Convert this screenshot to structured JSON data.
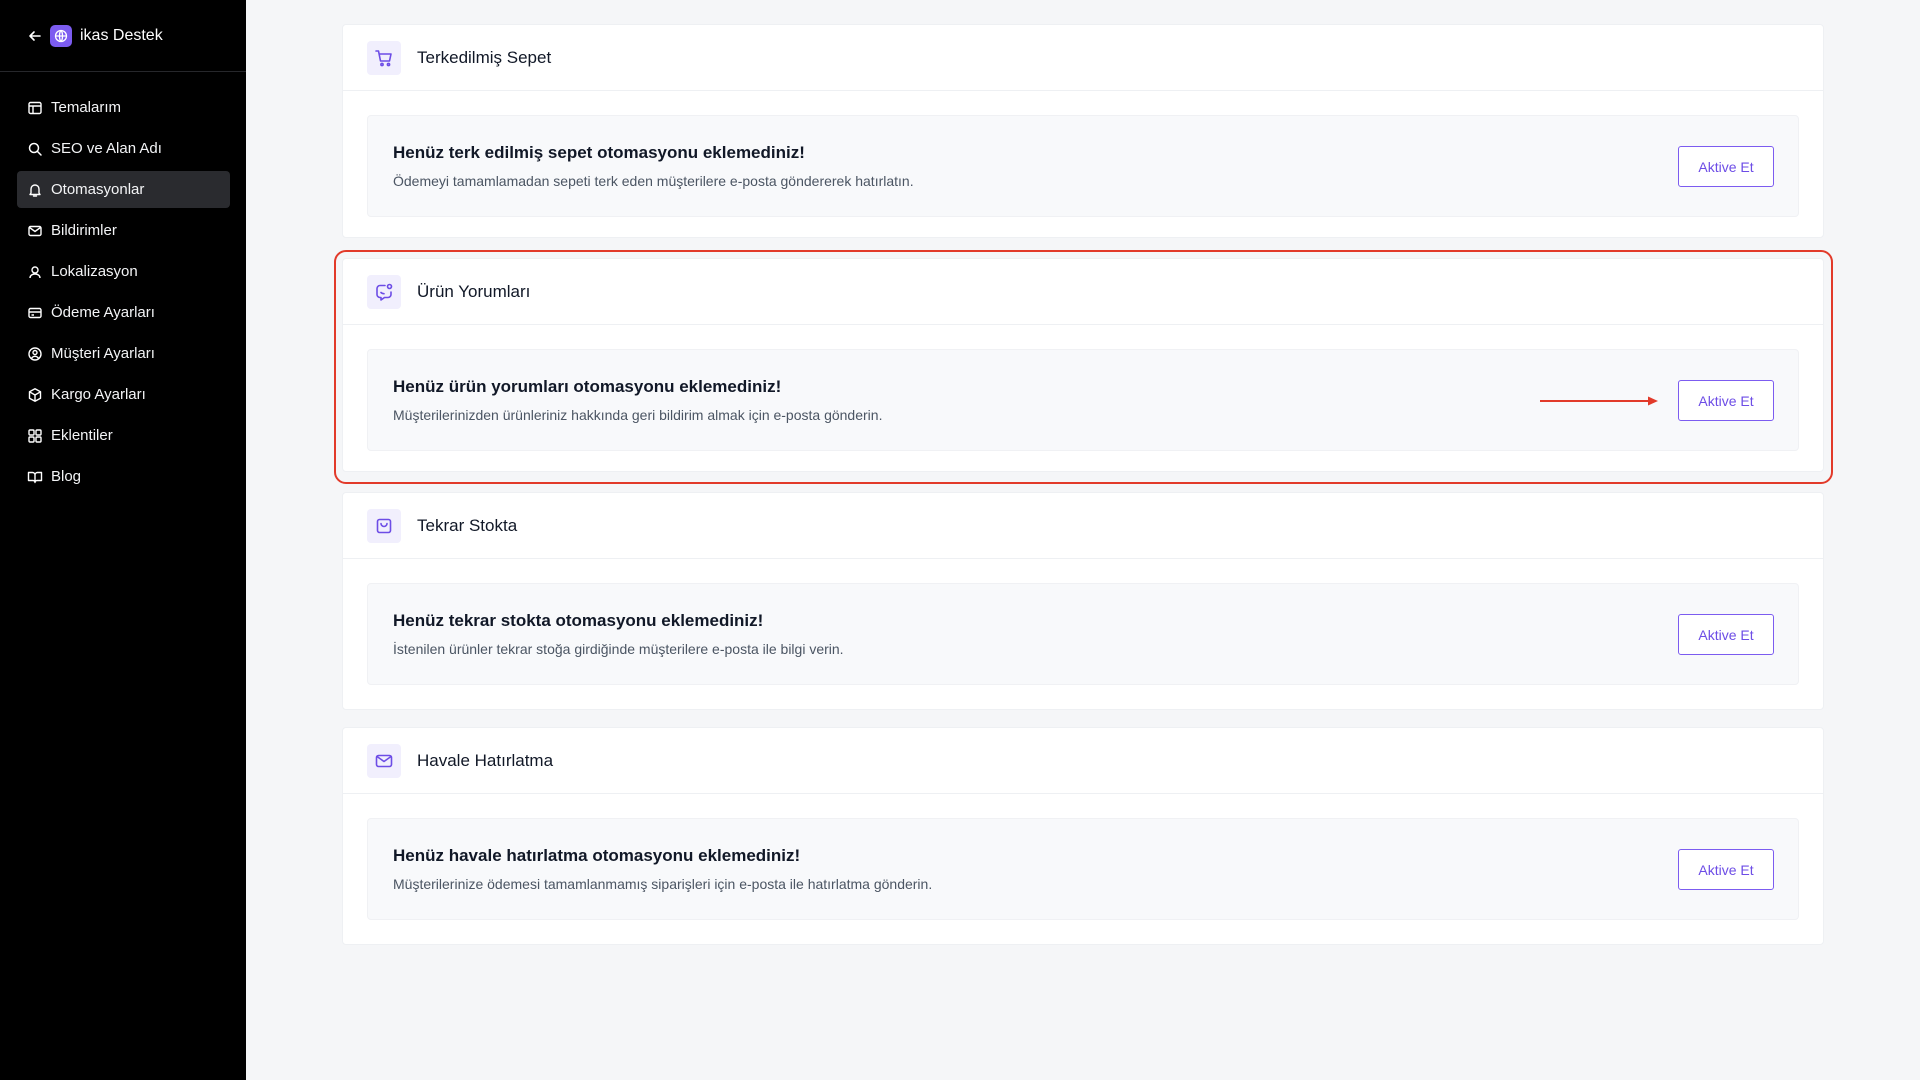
{
  "sidebar": {
    "store_name": "ikas Destek",
    "items": [
      {
        "label": "Temalarım",
        "icon": "layout-icon"
      },
      {
        "label": "SEO ve Alan Adı",
        "icon": "search-icon"
      },
      {
        "label": "Otomasyonlar",
        "icon": "bell-icon",
        "active": true
      },
      {
        "label": "Bildirimler",
        "icon": "mail-icon"
      },
      {
        "label": "Lokalizasyon",
        "icon": "user-pin-icon"
      },
      {
        "label": "Ödeme Ayarları",
        "icon": "credit-card-icon"
      },
      {
        "label": "Müşteri Ayarları",
        "icon": "user-circle-icon"
      },
      {
        "label": "Kargo Ayarları",
        "icon": "box-icon"
      },
      {
        "label": "Eklentiler",
        "icon": "grid-icon"
      },
      {
        "label": "Blog",
        "icon": "book-icon"
      }
    ]
  },
  "sections": [
    {
      "title": "Terkedilmiş Sepet",
      "icon": "cart-icon",
      "card_title": "Henüz terk edilmiş sepet otomasyonu eklemediniz!",
      "card_desc": "Ödemeyi tamamlamadan sepeti terk eden müşterilere e-posta göndererek hatırlatın.",
      "button": "Aktive Et"
    },
    {
      "title": "Ürün Yorumları",
      "icon": "chat-icon",
      "card_title": "Henüz ürün yorumları otomasyonu eklemediniz!",
      "card_desc": "Müşterilerinizden ürünleriniz hakkında geri bildirim almak için e-posta gönderin.",
      "button": "Aktive Et"
    },
    {
      "title": "Tekrar Stokta",
      "icon": "bag-icon",
      "card_title": "Henüz tekrar stokta otomasyonu eklemediniz!",
      "card_desc": "İstenilen ürünler tekrar stoğa girdiğinde müşterilere e-posta ile bilgi verin.",
      "button": "Aktive Et"
    },
    {
      "title": "Havale Hatırlatma",
      "icon": "envelope-icon",
      "card_title": "Henüz havale hatırlatma otomasyonu eklemediniz!",
      "card_desc": "Müşterilerinize ödemesi tamamlanmamış siparişleri için e-posta ile hatırlatma gönderin.",
      "button": "Aktive Et"
    }
  ],
  "colors": {
    "accent": "#7c5cf0",
    "highlight": "#e23a2a",
    "sidebar_bg": "#000000"
  }
}
